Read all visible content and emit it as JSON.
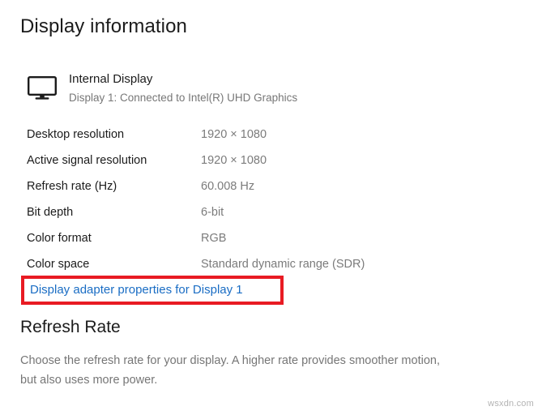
{
  "page": {
    "title": "Display information",
    "background_color": "#ffffff"
  },
  "display_header": {
    "icon": "monitor-icon",
    "name": "Internal Display",
    "subtitle": "Display 1: Connected to Intel(R) UHD Graphics"
  },
  "info_rows": [
    {
      "label": "Desktop resolution",
      "value": "1920 × 1080"
    },
    {
      "label": "Active signal resolution",
      "value": "1920 × 1080"
    },
    {
      "label": "Refresh rate (Hz)",
      "value": "60.008 Hz"
    },
    {
      "label": "Bit depth",
      "value": "6-bit"
    },
    {
      "label": "Color format",
      "value": "RGB"
    },
    {
      "label": "Color space",
      "value": "Standard dynamic range (SDR)"
    }
  ],
  "adapter_link": {
    "label": "Display adapter properties for Display 1",
    "color": "#1a6dc4",
    "highlight_color": "#e81b23"
  },
  "refresh_rate_section": {
    "title": "Refresh Rate",
    "description": "Choose the refresh rate for your display. A higher rate provides smoother motion, but also uses more power."
  },
  "watermark": {
    "text": "wsxdn.com"
  }
}
